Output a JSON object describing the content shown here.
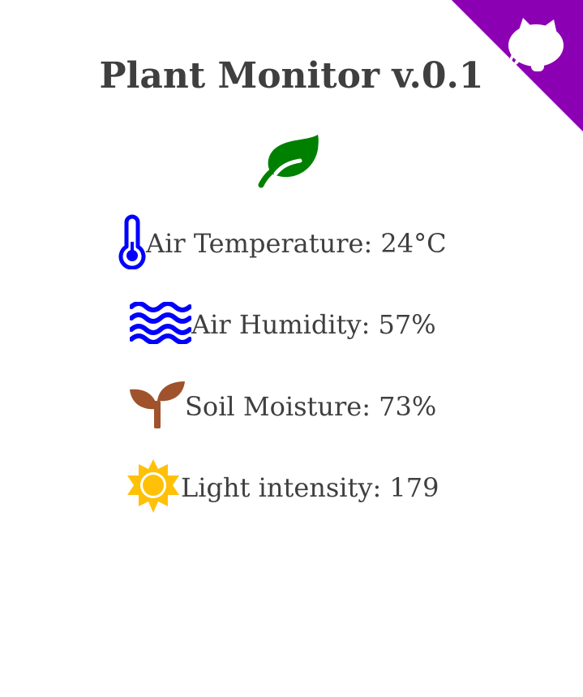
{
  "page": {
    "title": "Plant Monitor v.0.1",
    "header_icon": "leaf-icon",
    "header_icon_color": "#008000"
  },
  "github_corner": {
    "icon": "github-octocat-icon",
    "background_color": "#8b00b3",
    "icon_color": "#ffffff"
  },
  "readings": {
    "air_temperature": {
      "label": "Air Temperature: 24°C",
      "icon": "thermometer-icon",
      "icon_color": "#0000ff"
    },
    "air_humidity": {
      "label": "Air Humidity: 57%",
      "icon": "water-waves-icon",
      "icon_color": "#0000ff"
    },
    "soil_moisture": {
      "label": "Soil Moisture: 73%",
      "icon": "seedling-icon",
      "icon_color": "#a0522d"
    },
    "light_intensity": {
      "label": "Light intensity: 179",
      "icon": "sun-icon",
      "icon_color": "#ffc107"
    }
  }
}
